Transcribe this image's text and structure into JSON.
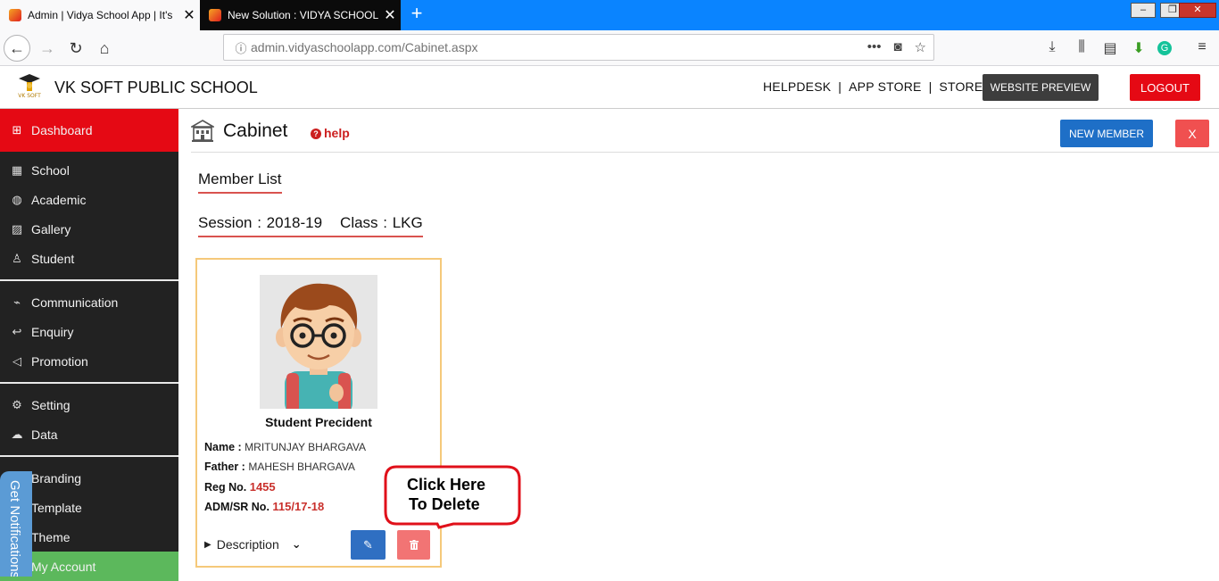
{
  "browser": {
    "tabs": [
      {
        "title": "Admin | Vidya School App | It's",
        "active": true
      },
      {
        "title": "New Solution : VIDYA SCHOOL",
        "active": false
      }
    ],
    "url": {
      "host": "admin.vidyaschoolapp.com",
      "path": "/Cabinet.aspx"
    }
  },
  "header": {
    "school_name": "VK SOFT PUBLIC SCHOOL",
    "logo_text": "VK SOFT",
    "links": [
      "HELPDESK",
      "APP STORE",
      "STORE"
    ],
    "separator": "|",
    "preview_label": "WEBSITE PREVIEW",
    "logout_label": "LOGOUT"
  },
  "sidebar": {
    "items": [
      {
        "label": "Dashboard",
        "icon": "dashboard-icon"
      },
      {
        "label": "School",
        "icon": "school-icon"
      },
      {
        "label": "Academic",
        "icon": "globe-icon"
      },
      {
        "label": "Gallery",
        "icon": "image-icon"
      },
      {
        "label": "Student",
        "icon": "student-icon"
      },
      {
        "label": "Communication",
        "icon": "plug-icon"
      },
      {
        "label": "Enquiry",
        "icon": "reply-icon"
      },
      {
        "label": "Promotion",
        "icon": "megaphone-icon"
      },
      {
        "label": "Setting",
        "icon": "gear-icon"
      },
      {
        "label": "Data",
        "icon": "cloud-icon"
      },
      {
        "label": "Branding",
        "icon": "brush-icon"
      },
      {
        "label": "Template",
        "icon": "template-icon"
      },
      {
        "label": "Theme",
        "icon": "theme-icon"
      },
      {
        "label": "My Account",
        "icon": "user-icon"
      }
    ],
    "notification_tab": "Get Notifications"
  },
  "main": {
    "title": "Cabinet",
    "help_label": "help",
    "new_member_label": "NEW MEMBER",
    "close_label": "X",
    "member_list_heading": "Member List",
    "session_label": "Session : 2018-19",
    "class_label": "Class : LKG"
  },
  "card": {
    "role": "Student Precident",
    "name_label": "Name :",
    "name": "MRITUNJAY BHARGAVA",
    "father_label": "Father :",
    "father": "MAHESH BHARGAVA",
    "reg_label": "Reg No.",
    "reg": "1455",
    "adm_label": "ADM/SR No.",
    "adm": "115/17-18",
    "description_label": "Description"
  },
  "callout": {
    "line1": "Click Here",
    "line2": "To Delete"
  },
  "colors": {
    "accent_red": "#e50914",
    "sidebar_bg": "#222222",
    "primary_blue": "#1e6fc7",
    "account_green": "#5cb85c",
    "card_border": "#f5c97a"
  }
}
